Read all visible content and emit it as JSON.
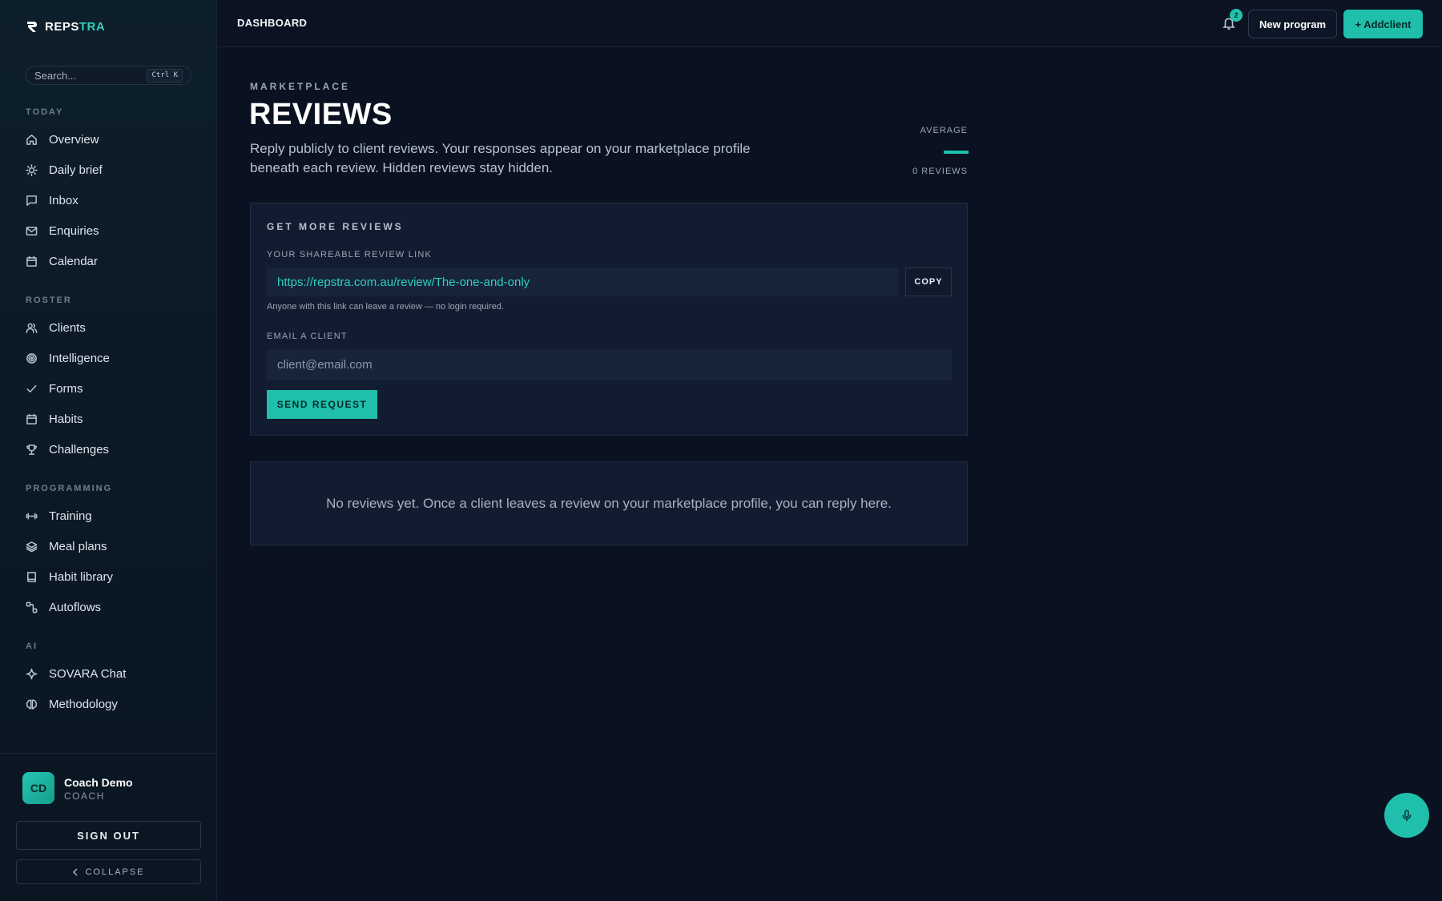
{
  "brand": {
    "name_main": "REPS",
    "name_accent": "TRA"
  },
  "search": {
    "placeholder": "Search...",
    "shortcut": "Ctrl K"
  },
  "sidebar": {
    "sections": [
      {
        "label": "TODAY",
        "items": [
          {
            "label": "Overview",
            "icon": "home-icon"
          },
          {
            "label": "Daily brief",
            "icon": "sun-icon"
          },
          {
            "label": "Inbox",
            "icon": "chat-icon"
          },
          {
            "label": "Enquiries",
            "icon": "mail-icon"
          },
          {
            "label": "Calendar",
            "icon": "calendar-icon"
          }
        ]
      },
      {
        "label": "ROSTER",
        "items": [
          {
            "label": "Clients",
            "icon": "users-icon"
          },
          {
            "label": "Intelligence",
            "icon": "target-icon"
          },
          {
            "label": "Forms",
            "icon": "check-icon"
          },
          {
            "label": "Habits",
            "icon": "calendar-icon"
          },
          {
            "label": "Challenges",
            "icon": "trophy-icon"
          }
        ]
      },
      {
        "label": "PROGRAMMING",
        "items": [
          {
            "label": "Training",
            "icon": "dumbbell-icon"
          },
          {
            "label": "Meal plans",
            "icon": "layers-icon"
          },
          {
            "label": "Habit library",
            "icon": "book-icon"
          },
          {
            "label": "Autoflows",
            "icon": "flow-icon"
          }
        ]
      },
      {
        "label": "AI",
        "items": [
          {
            "label": "SOVARA Chat",
            "icon": "sparkle-icon"
          },
          {
            "label": "Methodology",
            "icon": "brain-icon"
          }
        ]
      }
    ]
  },
  "user": {
    "initials": "CD",
    "name": "Coach Demo",
    "role": "COACH"
  },
  "sidebar_footer": {
    "signout": "SIGN OUT",
    "collapse": "COLLAPSE"
  },
  "topbar": {
    "title": "DASHBOARD",
    "notification_count": "2",
    "new_program": "New program",
    "add_client": "+ Addclient"
  },
  "main": {
    "eyebrow": "MARKETPLACE",
    "title": "REVIEWS",
    "description": "Reply publicly to client reviews. Your responses appear on your marketplace profile beneath each review. Hidden reviews stay hidden.",
    "average_label": "AVERAGE",
    "review_count": "0 REVIEWS",
    "get_more": {
      "title": "GET MORE REVIEWS",
      "link_label": "YOUR SHAREABLE REVIEW LINK",
      "link_value": "https://repstra.com.au/review/The-one-and-only",
      "copy": "COPY",
      "hint": "Anyone with this link can leave a review — no login required.",
      "email_label": "EMAIL A CLIENT",
      "email_placeholder": "client@email.com",
      "send": "SEND REQUEST"
    },
    "empty_state": "No reviews yet. Once a client leaves a review on your marketplace profile, you can reply here."
  },
  "colors": {
    "accent": "#1fbfac",
    "background": "#0a1120",
    "card": "#111c30"
  }
}
